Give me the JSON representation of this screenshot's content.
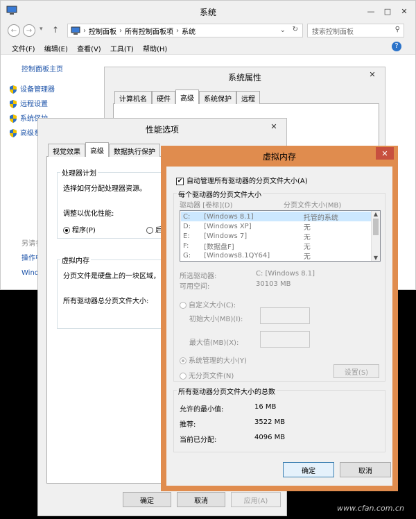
{
  "system_window": {
    "title": "系统",
    "breadcrumb": [
      "控制面板",
      "所有控制面板项",
      "系统"
    ],
    "search_placeholder": "搜索控制面板",
    "menu": [
      "文件(F)",
      "编辑(E)",
      "查看(V)",
      "工具(T)",
      "帮助(H)"
    ],
    "sidebar_home": "控制面板主页",
    "sidebar_items": [
      "设备管理器",
      "远程设置",
      "系统保护",
      "高级系"
    ],
    "see_also": [
      "另请参",
      "操作中",
      "Wind"
    ]
  },
  "sys_props": {
    "title": "系统属性",
    "tabs": [
      "计算机名",
      "硬件",
      "高级",
      "系统保护",
      "远程"
    ]
  },
  "perf": {
    "title": "性能选项",
    "tabs": [
      "视觉效果",
      "高级",
      "数据执行保护"
    ],
    "cpu_group": "处理器计划",
    "cpu_desc": "选择如何分配处理器资源。",
    "cpu_adjust": "调整以优化性能:",
    "opt_programs": "程序(P)",
    "opt_background": "后",
    "vm_group": "虚拟内存",
    "vm_desc": "分页文件是硬盘上的一块区域，",
    "vm_total": "所有驱动器总分页文件大小:",
    "ok": "确定",
    "cancel": "取消",
    "apply": "应用(A)"
  },
  "vm": {
    "title": "虚拟内存",
    "auto_manage": "自动管理所有驱动器的分页文件大小(A)",
    "auto_checked": true,
    "per_drive_group": "每个驱动器的分页文件大小",
    "col_drive": "驱动器 [卷标](D)",
    "col_size": "分页文件大小(MB)",
    "drives": [
      {
        "letter": "C:",
        "label": "[Windows 8.1]",
        "size": "托管的系统",
        "selected": true
      },
      {
        "letter": "D:",
        "label": "[Windows XP]",
        "size": "无",
        "selected": false
      },
      {
        "letter": "E:",
        "label": "[Windows 7]",
        "size": "无",
        "selected": false
      },
      {
        "letter": "F:",
        "label": "[数据盘F]",
        "size": "无",
        "selected": false
      },
      {
        "letter": "G:",
        "label": "[Windows8.1QY64]",
        "size": "无",
        "selected": false
      }
    ],
    "selected_drive_label": "所选驱动器:",
    "selected_drive_value": "C:  [Windows 8.1]",
    "free_space_label": "可用空间:",
    "free_space_value": "30103 MB",
    "custom_size": "自定义大小(C):",
    "initial_size": "初始大小(MB)(I):",
    "max_size": "最大值(MB)(X):",
    "system_managed": "系统管理的大小(Y)",
    "no_paging": "无分页文件(N)",
    "set_button": "设置(S)",
    "total_group": "所有驱动器分页文件大小的总数",
    "min_allowed_label": "允许的最小值:",
    "min_allowed_value": "16 MB",
    "recommended_label": "推荐:",
    "recommended_value": "3522 MB",
    "current_label": "当前已分配:",
    "current_value": "4096 MB",
    "ok": "确定",
    "cancel": "取消"
  },
  "watermark": "www.cfan.com.cn",
  "colors": {
    "vm_border": "#e08c4e",
    "link": "#1b52a8",
    "selection": "#cce8ff"
  }
}
